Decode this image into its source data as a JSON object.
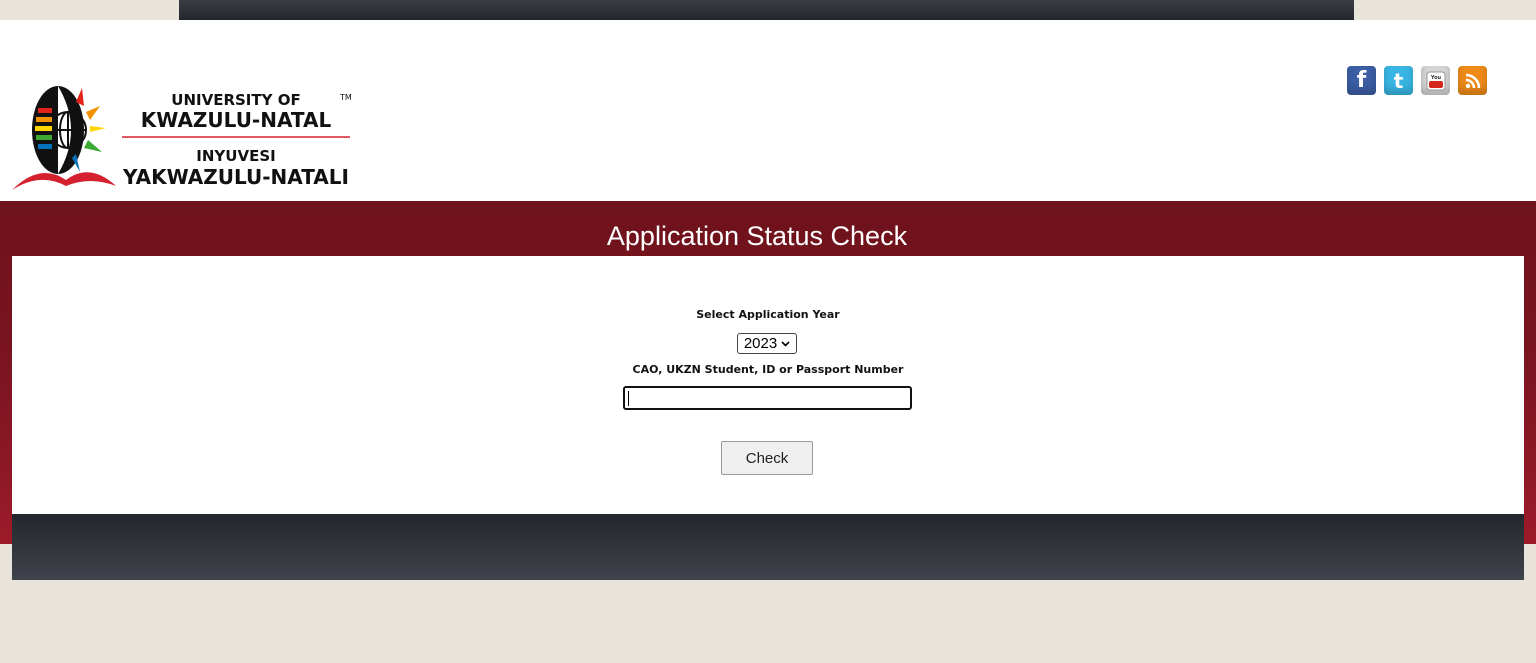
{
  "logo": {
    "line1": "UNIVERSITY OF",
    "line2": "KWAZULU-NATAL",
    "line3": "INYUVESI",
    "line4": "YAKWAZULU-NATALI",
    "tm": "TM"
  },
  "social": [
    {
      "name": "facebook",
      "glyph": "f"
    },
    {
      "name": "twitter",
      "glyph": "t"
    },
    {
      "name": "youtube",
      "glyph": "You"
    },
    {
      "name": "rss",
      "glyph": ""
    }
  ],
  "page": {
    "title": "Application Status Check"
  },
  "form": {
    "year_label": "Select Application Year",
    "year_value": "2023",
    "id_label": "CAO, UKZN Student, ID or Passport Number",
    "id_value": "",
    "check_label": "Check"
  },
  "colors": {
    "maroon": "#6e121b",
    "background": "#e8e4da",
    "dark_bar": "#23262c"
  }
}
